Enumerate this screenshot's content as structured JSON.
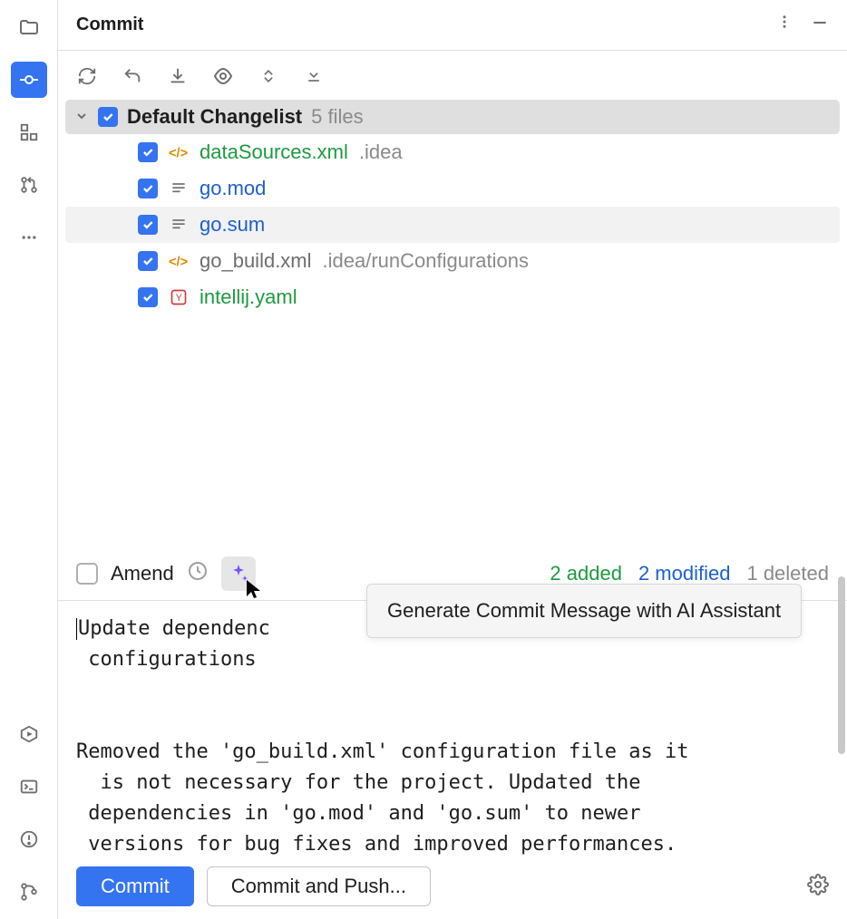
{
  "header": {
    "title": "Commit"
  },
  "changelist": {
    "title": "Default Changelist",
    "count_label": "5 files",
    "files": [
      {
        "name": "dataSources.xml",
        "path": ".idea",
        "status": "added",
        "icon": "xml"
      },
      {
        "name": "go.mod",
        "path": "",
        "status": "modified",
        "icon": "text"
      },
      {
        "name": "go.sum",
        "path": "",
        "status": "modified",
        "icon": "text",
        "highlight": true
      },
      {
        "name": "go_build.xml",
        "path": ".idea/runConfigurations",
        "status": "deleted",
        "icon": "xml"
      },
      {
        "name": "intellij.yaml",
        "path": "",
        "status": "added",
        "icon": "yaml"
      }
    ]
  },
  "amend": {
    "label": "Amend"
  },
  "stats": {
    "added": "2 added",
    "modified": "2 modified",
    "deleted": "1 deleted"
  },
  "tooltip": "Generate Commit Message with AI Assistant",
  "commit_message": "Update dependenc\n configurations\n\n\nRemoved the 'go_build.xml' configuration file as it\n  is not necessary for the project. Updated the\n dependencies in 'go.mod' and 'go.sum' to newer\n versions for bug fixes and improved performances.",
  "buttons": {
    "commit": "Commit",
    "commit_push": "Commit and Push..."
  }
}
